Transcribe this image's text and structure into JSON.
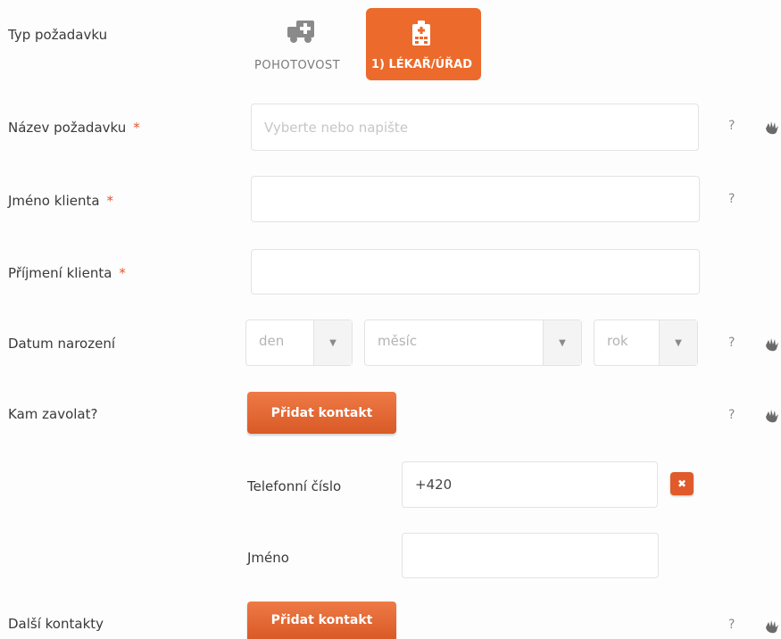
{
  "typ": {
    "label": "Typ požadavku",
    "options": [
      {
        "label": "POHOTOVOST",
        "icon": "ambulance-icon"
      },
      {
        "label": "1) LÉKAŘ/ÚŘAD",
        "icon": "hospital-icon",
        "selected": true
      }
    ]
  },
  "nazev": {
    "label": "Název požadavku",
    "required": "*",
    "placeholder": "Vyberte nebo napište",
    "help": "?"
  },
  "jmeno": {
    "label": "Jméno klienta",
    "required": "*",
    "value": "",
    "help": "?"
  },
  "prijmeni": {
    "label": "Příjmení klienta",
    "required": "*",
    "value": ""
  },
  "datum": {
    "label": "Datum narození",
    "den": "den",
    "mesic": "měsíc",
    "rok": "rok",
    "arrow": "▼",
    "help": "?"
  },
  "kam": {
    "label": "Kam zavolat?",
    "button": "Přidat kontakt",
    "help": "?"
  },
  "kontakt": {
    "phone_label": "Telefonní číslo",
    "phone_value": "+420",
    "remove": "✖",
    "name_label": "Jméno",
    "name_value": ""
  },
  "dalsi": {
    "label": "Další kontakty",
    "button": "Přidat kontakt",
    "help": "?"
  },
  "colors": {
    "accent": "#ec6a2c",
    "required": "#e8542b"
  }
}
